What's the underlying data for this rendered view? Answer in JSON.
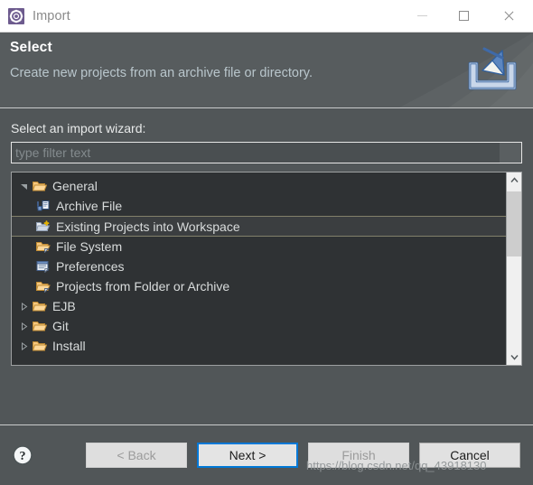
{
  "window": {
    "title": "Import",
    "icon": "eclipse-gear-icon",
    "controls": {
      "minimize": "minimize-icon",
      "maximize": "maximize-icon",
      "close": "close-icon"
    }
  },
  "header": {
    "title": "Select",
    "subtitle": "Create new projects from an archive file or directory.",
    "icon": "import-tray-icon"
  },
  "main": {
    "field_label": "Select an import wizard:",
    "filter": {
      "placeholder": "type filter text",
      "value": ""
    },
    "tree": [
      {
        "label": "General",
        "icon": "folder-open-icon",
        "level": 0,
        "state": "expanded",
        "selected": false
      },
      {
        "label": "Archive File",
        "icon": "archive-file-icon",
        "level": 1,
        "state": "leaf",
        "selected": false
      },
      {
        "label": "Existing Projects into Workspace",
        "icon": "folder-import-icon",
        "level": 1,
        "state": "leaf",
        "selected": true
      },
      {
        "label": "File System",
        "icon": "folder-edit-icon",
        "level": 1,
        "state": "leaf",
        "selected": false
      },
      {
        "label": "Preferences",
        "icon": "preferences-icon",
        "level": 1,
        "state": "leaf",
        "selected": false
      },
      {
        "label": "Projects from Folder or Archive",
        "icon": "folder-edit-icon",
        "level": 1,
        "state": "leaf",
        "selected": false
      },
      {
        "label": "EJB",
        "icon": "folder-open-icon",
        "level": 0,
        "state": "collapsed",
        "selected": false
      },
      {
        "label": "Git",
        "icon": "folder-open-icon",
        "level": 0,
        "state": "collapsed",
        "selected": false
      },
      {
        "label": "Install",
        "icon": "folder-open-icon",
        "level": 0,
        "state": "collapsed",
        "selected": false
      }
    ],
    "scrollbar": {
      "up": "chevron-up-icon",
      "down": "chevron-down-icon"
    }
  },
  "footer": {
    "help": "help-icon",
    "buttons": [
      {
        "label": "< Back",
        "state": "disabled"
      },
      {
        "label": "Next >",
        "state": "focused"
      },
      {
        "label": "Finish",
        "state": "disabled"
      },
      {
        "label": "Cancel",
        "state": "normal"
      }
    ]
  },
  "watermark": "https://blog.csdn.net/qq_43918130",
  "colors": {
    "dialog_bg": "#515658",
    "tree_bg": "#2f3234",
    "accent_focus": "#0078d7",
    "title_icon_bg": "#6d5b8e",
    "subtitle_text": "#b9c6cc",
    "folder_icon": "#f0b95a"
  }
}
